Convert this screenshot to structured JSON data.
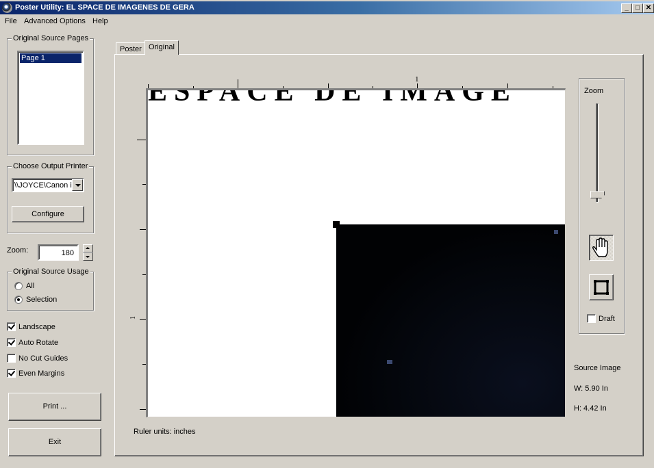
{
  "window": {
    "title": "Poster Utility:  EL SPACE DE IMAGENES DE GERA",
    "controls": {
      "minimize": "_",
      "maximize": "□",
      "close": "✕"
    }
  },
  "menu": [
    "File",
    "Advanced Options",
    "Help"
  ],
  "sidebar": {
    "source_pages": {
      "legend": "Original Source Pages",
      "items": [
        {
          "label": "Page 1",
          "selected": true
        }
      ]
    },
    "printer": {
      "legend": "Choose Output Printer",
      "selected": "\\\\JOYCE\\Canon iP",
      "configure_label": "Configure"
    },
    "zoom": {
      "label": "Zoom:",
      "value": "180"
    },
    "usage": {
      "legend": "Original Source Usage",
      "options": [
        {
          "label": "All",
          "checked": false
        },
        {
          "label": "Selection",
          "checked": true
        }
      ]
    },
    "checkboxes": [
      {
        "label": "Landscape",
        "checked": true
      },
      {
        "label": "Auto Rotate",
        "checked": true
      },
      {
        "label": "No Cut Guides",
        "checked": false
      },
      {
        "label": "Even Margins",
        "checked": true
      }
    ],
    "print_label": "Print ...",
    "exit_label": "Exit"
  },
  "tabs": [
    {
      "label": "Poster",
      "active": false
    },
    {
      "label": "Original",
      "active": true
    }
  ],
  "preview": {
    "banner_text": "ESPACE DE IMAGE",
    "ruler_h_label": "1",
    "ruler_v_label": "1",
    "ruler_units_label": "Ruler units:  inches"
  },
  "zoom_panel": {
    "label": "Zoom",
    "slider_value_fraction": 0.08,
    "hand_tool": "hand-pan-icon",
    "crop_tool": "crop-rect-icon",
    "draft_label": "Draft",
    "draft_checked": false
  },
  "source_image": {
    "title": "Source Image",
    "width": "W: 5.90 In",
    "height": "H: 4.42 In"
  }
}
